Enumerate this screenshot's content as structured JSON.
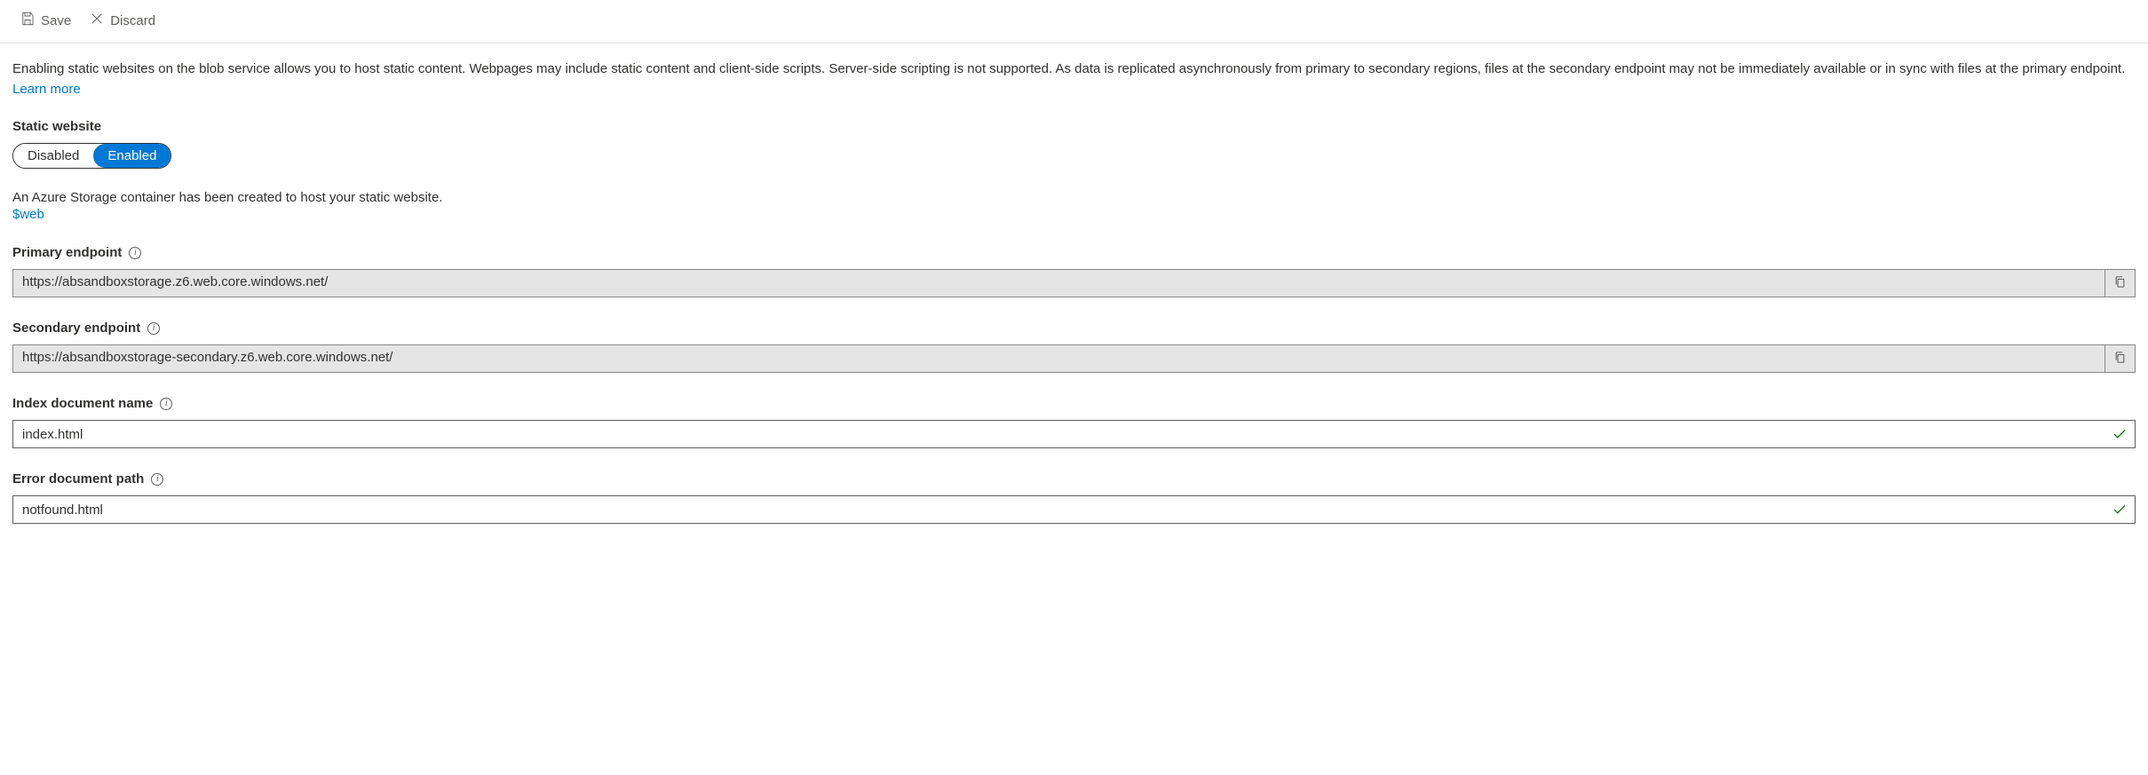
{
  "toolbar": {
    "save_label": "Save",
    "discard_label": "Discard"
  },
  "description": {
    "text": "Enabling static websites on the blob service allows you to host static content. Webpages may include static content and client-side scripts. Server-side scripting is not supported. As data is replicated asynchronously from primary to secondary regions, files at the secondary endpoint may not be immediately available or in sync with files at the primary endpoint. ",
    "learn_more_label": "Learn more"
  },
  "static_website": {
    "label": "Static website",
    "disabled_label": "Disabled",
    "enabled_label": "Enabled",
    "selected": "Enabled"
  },
  "container": {
    "created_text": "An Azure Storage container has been created to host your static website.",
    "link_label": "$web"
  },
  "primary_endpoint": {
    "label": "Primary endpoint",
    "value": "https://absandboxstorage.z6.web.core.windows.net/"
  },
  "secondary_endpoint": {
    "label": "Secondary endpoint",
    "value": "https://absandboxstorage-secondary.z6.web.core.windows.net/"
  },
  "index_document": {
    "label": "Index document name",
    "value": "index.html"
  },
  "error_document": {
    "label": "Error document path",
    "value": "notfound.html"
  }
}
